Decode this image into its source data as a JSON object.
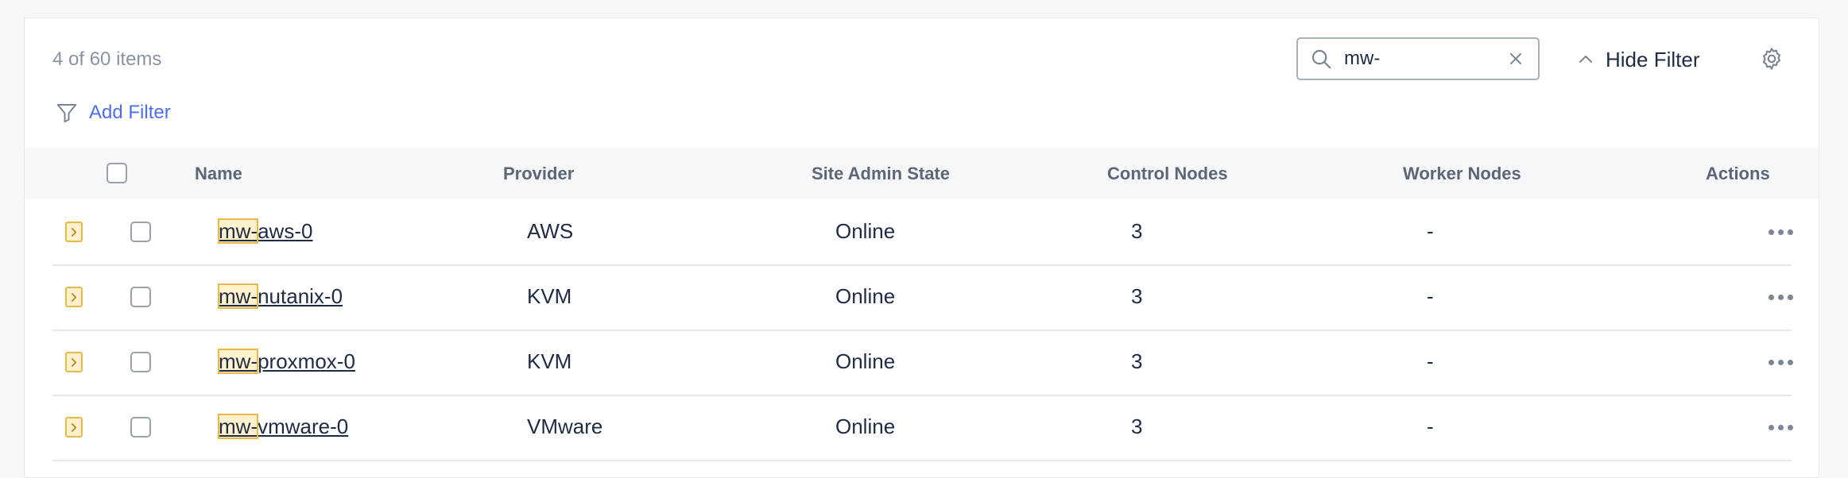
{
  "toolbar": {
    "item_count": "4 of 60 items",
    "add_filter": "Add Filter",
    "search_value": "mw-",
    "hide_filter": "Hide Filter"
  },
  "icons": {
    "filter": "funnel-icon",
    "search": "search-icon",
    "clear": "close-icon",
    "hide": "chevron-up-icon",
    "settings": "gear-icon",
    "expand": "chevron-right-icon",
    "actions": "more-horizontal-icon"
  },
  "colors": {
    "accent": "#4d6ef2",
    "highlight_bg": "#fff1cc",
    "highlight_border": "#e8b84a"
  },
  "table": {
    "columns": [
      "Name",
      "Provider",
      "Site Admin State",
      "Control Nodes",
      "Worker Nodes",
      "Actions"
    ],
    "rows": [
      {
        "match": "mw-",
        "rest": "aws-0",
        "provider": "AWS",
        "state": "Online",
        "control": "3",
        "worker": "-"
      },
      {
        "match": "mw-",
        "rest": "nutanix-0",
        "provider": "KVM",
        "state": "Online",
        "control": "3",
        "worker": "-"
      },
      {
        "match": "mw-",
        "rest": "proxmox-0",
        "provider": "KVM",
        "state": "Online",
        "control": "3",
        "worker": "-"
      },
      {
        "match": "mw-",
        "rest": "vmware-0",
        "provider": "VMware",
        "state": "Online",
        "control": "3",
        "worker": "-"
      }
    ]
  }
}
